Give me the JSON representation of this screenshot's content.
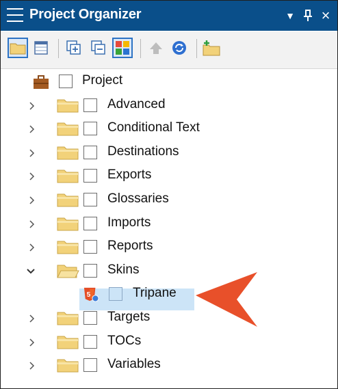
{
  "panel": {
    "title": "Project Organizer",
    "dropdown_glyph": "▼",
    "pin_glyph": "ᵖ",
    "close_glyph": "×"
  },
  "toolbar": {
    "buttons": [
      {
        "icon": "open-folder-icon"
      },
      {
        "icon": "grid-view-icon"
      },
      {
        "icon": "expand-all-icon"
      },
      {
        "icon": "collapse-all-icon"
      },
      {
        "icon": "color-toggle-icon",
        "selected": true
      },
      {
        "icon": "disabled-move-icon"
      },
      {
        "icon": "refresh-icon"
      },
      {
        "icon": "new-folder-icon"
      }
    ]
  },
  "tree": {
    "root": {
      "label": "Project",
      "icon": "briefcase-icon"
    },
    "folders": [
      {
        "label": "Advanced",
        "expanded": false
      },
      {
        "label": "Conditional Text",
        "expanded": false
      },
      {
        "label": "Destinations",
        "expanded": false
      },
      {
        "label": "Exports",
        "expanded": false
      },
      {
        "label": "Glossaries",
        "expanded": false
      },
      {
        "label": "Imports",
        "expanded": false
      },
      {
        "label": "Reports",
        "expanded": false
      },
      {
        "label": "Skins",
        "expanded": true,
        "children": [
          {
            "label": "Tripane",
            "icon": "html5-skin-icon",
            "selected": true
          }
        ]
      },
      {
        "label": "Targets",
        "expanded": false
      },
      {
        "label": "TOCs",
        "expanded": false
      },
      {
        "label": "Variables",
        "expanded": false
      }
    ]
  },
  "colors": {
    "titlebar": "#0a4f8a",
    "selection": "#cce4f7",
    "callout_arrow": "#e8502a",
    "folder": "#f2d27a"
  }
}
